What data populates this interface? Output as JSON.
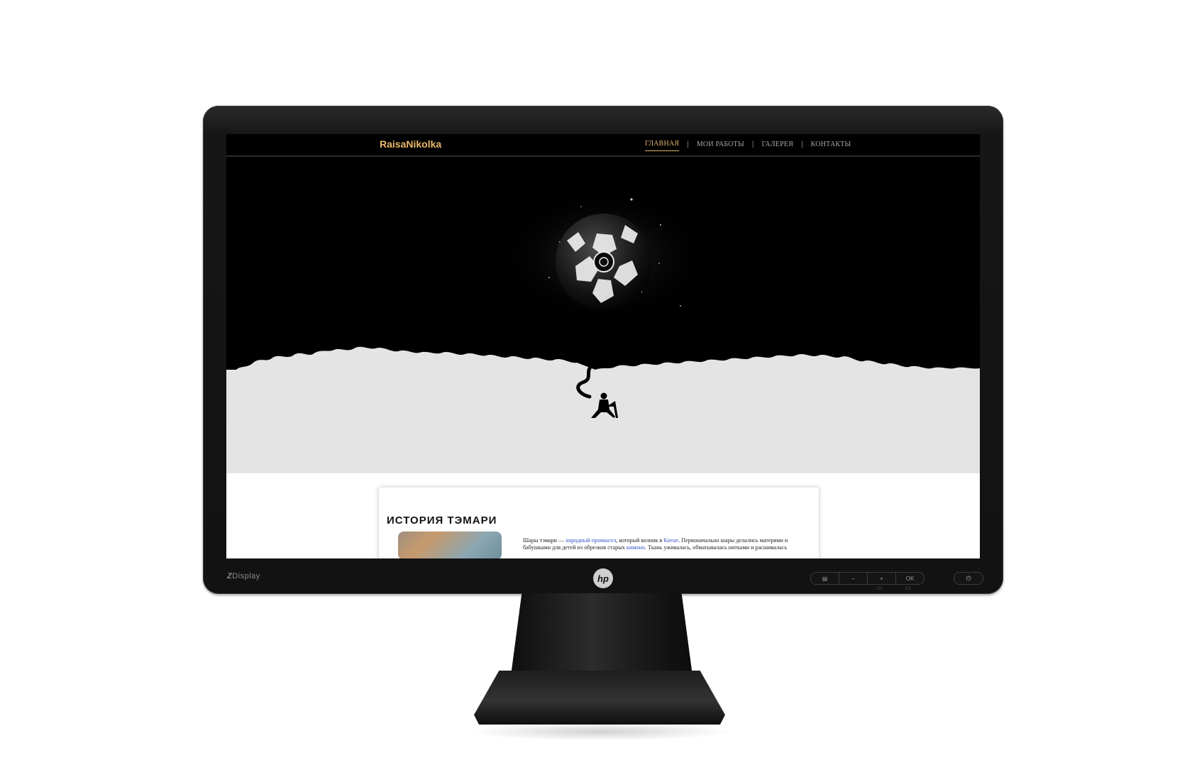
{
  "monitor": {
    "bezel_brand_prefix": "Z",
    "bezel_brand": "Display",
    "logo_text": "hp",
    "controls": [
      "▤",
      "–",
      "+",
      "OK"
    ],
    "power_icon": "⏻"
  },
  "site": {
    "logo": "RaisaNikolka",
    "nav": {
      "item_home": "ГЛАВНАЯ",
      "item_works": "МОИ РАБОТЫ",
      "item_gallery": "ГАЛЕРЕЯ",
      "item_contacts": "КОНТАКТЫ",
      "separator": "|"
    },
    "article": {
      "title": "ИСТОРИЯ ТЭМАРИ",
      "p1": "Шары тэмари — ",
      "link1": "народный промысел",
      "p2": ", который возник в ",
      "link2": "Китае",
      "p3": ". Первоначально шары делались матерями и бабушками для детей из обрезков старых ",
      "link3": "кимоно",
      "p4": ". Ткань уживалась, обматывалась нитками и расшивалась"
    }
  },
  "colors": {
    "accent": "#e2b36b",
    "link": "#3354c8",
    "hero_bg": "#000000",
    "ground": "#e6e6e6"
  }
}
